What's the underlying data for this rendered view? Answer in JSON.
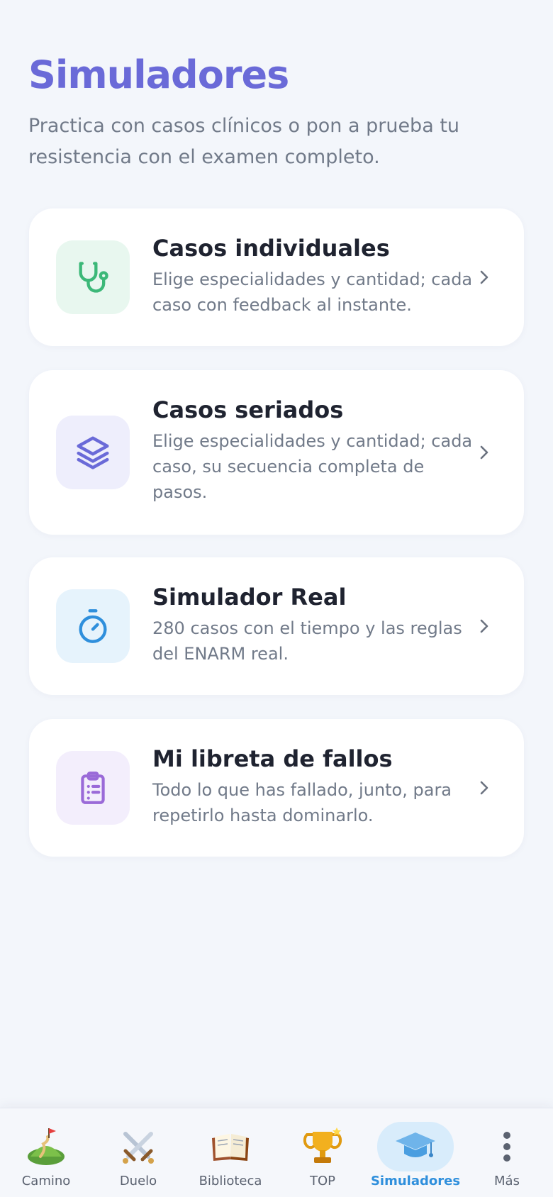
{
  "header": {
    "title": "Simuladores",
    "subtitle": "Practica con casos clínicos o pon a prueba tu resistencia con el examen completo."
  },
  "cards": [
    {
      "title": "Casos individuales",
      "description": "Elige especialidades y cantidad; cada caso con feedback al instante.",
      "icon": "stethoscope-icon",
      "accent": "#3cb878",
      "icon_bg": "#e8f7ef"
    },
    {
      "title": "Casos seriados",
      "description": "Elige especialidades y cantidad; cada caso, su secuencia completa de pasos.",
      "icon": "layers-icon",
      "accent": "#6a6ad8",
      "icon_bg": "#eeeefc"
    },
    {
      "title": "Simulador Real",
      "description": "280 casos con el tiempo y las reglas del ENARM real.",
      "icon": "stopwatch-icon",
      "accent": "#2f8fdc",
      "icon_bg": "#e6f3fc"
    },
    {
      "title": "Mi libreta de fallos",
      "description": "Todo lo que has fallado, junto, para repetirlo hasta dominarlo.",
      "icon": "clipboard-list-icon",
      "accent": "#9a6ad8",
      "icon_bg": "#f3eefc"
    }
  ],
  "tabbar": {
    "items": [
      {
        "label": "Camino",
        "icon": "map-hill-flag-icon"
      },
      {
        "label": "Duelo",
        "icon": "crossed-swords-icon"
      },
      {
        "label": "Biblioteca",
        "icon": "open-book-icon"
      },
      {
        "label": "TOP",
        "icon": "trophy-icon"
      },
      {
        "label": "Simuladores",
        "icon": "graduation-cap-icon",
        "active": true
      },
      {
        "label": "Más",
        "icon": "more-vertical-icon"
      }
    ],
    "active_color": "#2f8fdc"
  }
}
